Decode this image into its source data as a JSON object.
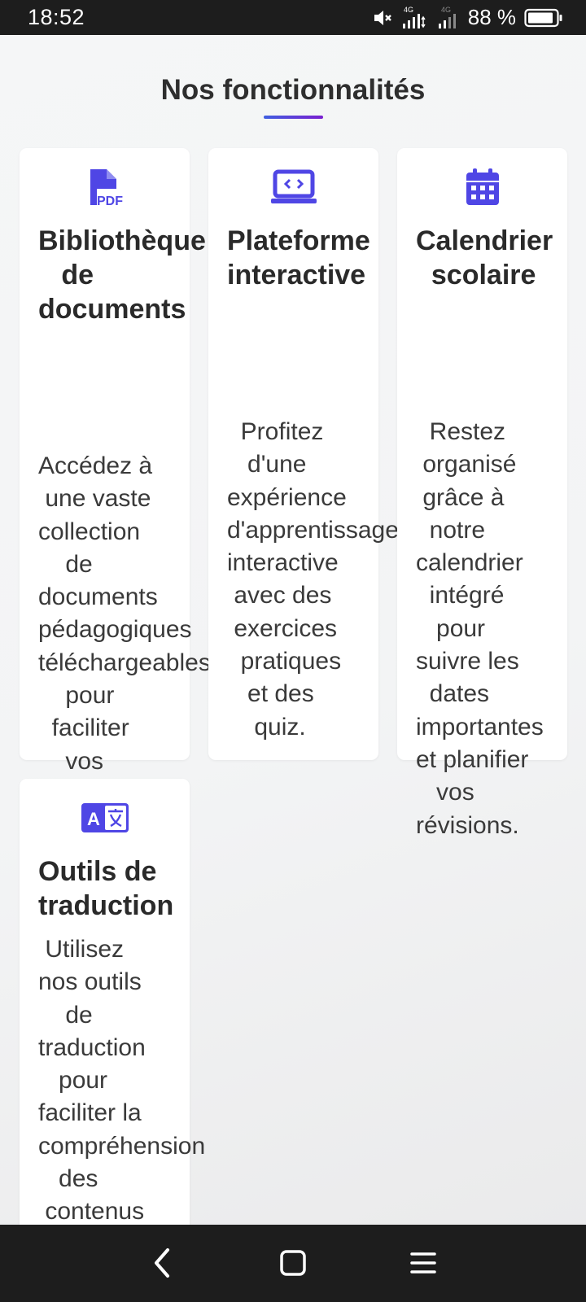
{
  "status_bar": {
    "time": "18:52",
    "battery_percent": "88 %",
    "network_label": "4G",
    "icons": [
      "mute-icon",
      "signal-4g-icon",
      "signal-4g-icon",
      "battery-icon"
    ]
  },
  "section": {
    "title": "Nos fonctionnalités"
  },
  "cards": [
    {
      "icon": "pdf-file-icon",
      "title_lines": "Bibliothèque\n   de\ndocuments",
      "description": "Accédez à\n une vaste\ncollection\n    de\ndocuments\npédagogiques\ntéléchargeables\n    pour\n  faciliter\n    vos\n  études."
    },
    {
      "icon": "laptop-code-icon",
      "title_lines": "Plateforme\ninteractive",
      "description": "  Profitez\n   d'une\nexpérience\nd'apprentissage\ninteractive\n avec des\n exercices\n  pratiques\n   et des\n    quiz."
    },
    {
      "icon": "calendar-icon",
      "title_lines": "Calendrier\n  scolaire",
      "description": "  Restez\n organisé\n grâce à\n  notre\ncalendrier\n  intégré\n   pour\nsuivre les\n  dates\nimportantes\net planifier\n   vos\nrévisions."
    },
    {
      "icon": "translate-icon",
      "title_lines": "Outils de\ntraduction",
      "description": " Utilisez\nnos outils\n    de\ntraduction\n   pour\nfaciliter la\ncompréhension\n   des\n contenus"
    }
  ],
  "colors": {
    "accent": "#4f46e5",
    "title_text": "#2e2e2e",
    "bars": "#1d1d1d"
  },
  "nav": {
    "icons": [
      "back-icon",
      "home-icon",
      "menu-icon"
    ]
  }
}
